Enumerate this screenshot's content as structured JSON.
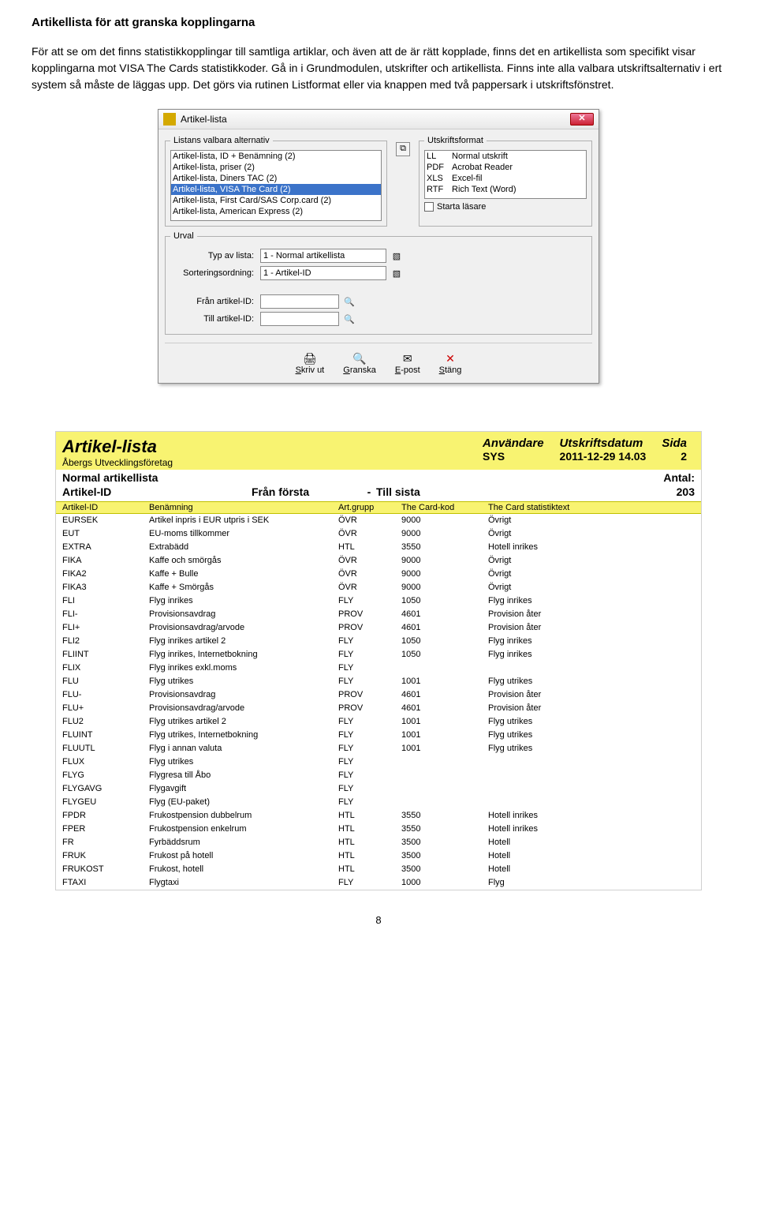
{
  "doc": {
    "title": "Artikellista för att granska kopplingarna",
    "body": "För att se om det finns statistikkopplingar till samtliga artiklar, och även att de är rätt kopplade, finns det en artikellista som specifikt visar kopplingarna mot VISA The Cards statistikkoder. Gå in i Grundmodulen, utskrifter och artikellista. Finns inte alla valbara utskriftsalternativ i ert system så måste de läggas upp. Det görs via rutinen Listformat eller via knappen med två pappersark i utskriftsfönstret."
  },
  "dialog": {
    "title": "Artikel-lista",
    "fs_listans": "Listans valbara alternativ",
    "fs_utskrift": "Utskriftsformat",
    "fs_urval": "Urval",
    "list_items": [
      "Artikel-lista, ID + Benämning (2)",
      "Artikel-lista, priser (2)",
      "Artikel-lista, Diners TAC (2)",
      "Artikel-lista, VISA The Card (2)",
      "Artikel-lista, First Card/SAS Corp.card (2)",
      "Artikel-lista, American Express (2)"
    ],
    "list_selected": 3,
    "formats": [
      {
        "c": "LL",
        "n": "Normal utskrift"
      },
      {
        "c": "PDF",
        "n": "Acrobat Reader"
      },
      {
        "c": "XLS",
        "n": "Excel-fil"
      },
      {
        "c": "RTF",
        "n": "Rich Text (Word)"
      }
    ],
    "starta_lasare": "Starta läsare",
    "lbl_typ": "Typ av lista:",
    "lbl_sort": "Sorteringsordning:",
    "val_typ": "1  - Normal artikellista",
    "val_sort": "1  - Artikel-ID",
    "lbl_fran": "Från artikel-ID:",
    "lbl_till": "Till artikel-ID:",
    "btn_skrivut_pre": "S",
    "btn_skrivut": "kriv ut",
    "btn_granska_pre": "G",
    "btn_granska": "ranska",
    "btn_epost_pre": "E",
    "btn_epost": "-post",
    "btn_stang_pre": "S",
    "btn_stang": "täng"
  },
  "report": {
    "title": "Artikel-lista",
    "company": "Åbergs Utvecklingsföretag",
    "h_user": "Användare",
    "v_user": "SYS",
    "h_date": "Utskriftsdatum",
    "v_date": "2011-12-29 14.03",
    "h_page": "Sida",
    "v_page": "2",
    "sub1": "Normal artikellista",
    "antal_lbl": "Antal:",
    "sub2_id": "Artikel-ID",
    "sub2_fran": "Från första",
    "sub2_dash": "-",
    "sub2_till": "Till sista",
    "antal_val": "203",
    "cols": {
      "id": "Artikel-ID",
      "ben": "Benämning",
      "grp": "Art.grupp",
      "kod": "The Card-kod",
      "txt": "The Card statistiktext"
    },
    "rows": [
      {
        "id": "EURSEK",
        "ben": "Artikel inpris i EUR utpris i SEK",
        "grp": "ÖVR",
        "kod": "9000",
        "txt": "Övrigt"
      },
      {
        "id": "EUT",
        "ben": "EU-moms tillkommer",
        "grp": "ÖVR",
        "kod": "9000",
        "txt": "Övrigt"
      },
      {
        "id": "EXTRA",
        "ben": "Extrabädd",
        "grp": "HTL",
        "kod": "3550",
        "txt": "Hotell inrikes"
      },
      {
        "id": "FIKA",
        "ben": "Kaffe och smörgås",
        "grp": "ÖVR",
        "kod": "9000",
        "txt": "Övrigt"
      },
      {
        "id": "FIKA2",
        "ben": "Kaffe + Bulle",
        "grp": "ÖVR",
        "kod": "9000",
        "txt": "Övrigt"
      },
      {
        "id": "FIKA3",
        "ben": "Kaffe + Smörgås",
        "grp": "ÖVR",
        "kod": "9000",
        "txt": "Övrigt"
      },
      {
        "id": "FLI",
        "ben": "Flyg inrikes",
        "grp": "FLY",
        "kod": "1050",
        "txt": "Flyg inrikes"
      },
      {
        "id": "FLI-",
        "ben": "Provisionsavdrag",
        "grp": "PROV",
        "kod": "4601",
        "txt": "Provision åter"
      },
      {
        "id": "FLI+",
        "ben": "Provisionsavdrag/arvode",
        "grp": "PROV",
        "kod": "4601",
        "txt": "Provision åter"
      },
      {
        "id": "FLI2",
        "ben": "Flyg inrikes artikel 2",
        "grp": "FLY",
        "kod": "1050",
        "txt": "Flyg inrikes"
      },
      {
        "id": "FLIINT",
        "ben": "Flyg inrikes, Internetbokning",
        "grp": "FLY",
        "kod": "1050",
        "txt": "Flyg inrikes"
      },
      {
        "id": "FLIX",
        "ben": "Flyg inrikes exkl.moms",
        "grp": "FLY",
        "kod": "",
        "txt": ""
      },
      {
        "id": "FLU",
        "ben": "Flyg utrikes",
        "grp": "FLY",
        "kod": "1001",
        "txt": "Flyg utrikes"
      },
      {
        "id": "FLU-",
        "ben": "Provisionsavdrag",
        "grp": "PROV",
        "kod": "4601",
        "txt": "Provision åter"
      },
      {
        "id": "FLU+",
        "ben": "Provisionsavdrag/arvode",
        "grp": "PROV",
        "kod": "4601",
        "txt": "Provision åter"
      },
      {
        "id": "FLU2",
        "ben": "Flyg utrikes artikel 2",
        "grp": "FLY",
        "kod": "1001",
        "txt": "Flyg utrikes"
      },
      {
        "id": "FLUINT",
        "ben": "Flyg utrikes, Internetbokning",
        "grp": "FLY",
        "kod": "1001",
        "txt": "Flyg utrikes"
      },
      {
        "id": "FLUUTL",
        "ben": "Flyg i annan valuta",
        "grp": "FLY",
        "kod": "1001",
        "txt": "Flyg utrikes"
      },
      {
        "id": "FLUX",
        "ben": "Flyg utrikes",
        "grp": "FLY",
        "kod": "",
        "txt": ""
      },
      {
        "id": "FLYG",
        "ben": "Flygresa till Åbo",
        "grp": "FLY",
        "kod": "",
        "txt": ""
      },
      {
        "id": "FLYGAVG",
        "ben": "Flygavgift",
        "grp": "FLY",
        "kod": "",
        "txt": ""
      },
      {
        "id": "FLYGEU",
        "ben": "Flyg (EU-paket)",
        "grp": "FLY",
        "kod": "",
        "txt": ""
      },
      {
        "id": "FPDR",
        "ben": "Frukostpension dubbelrum",
        "grp": "HTL",
        "kod": "3550",
        "txt": "Hotell inrikes"
      },
      {
        "id": "FPER",
        "ben": "Frukostpension enkelrum",
        "grp": "HTL",
        "kod": "3550",
        "txt": "Hotell inrikes"
      },
      {
        "id": "FR",
        "ben": "Fyrbäddsrum",
        "grp": "HTL",
        "kod": "3500",
        "txt": "Hotell"
      },
      {
        "id": "FRUK",
        "ben": "Frukost på hotell",
        "grp": "HTL",
        "kod": "3500",
        "txt": "Hotell"
      },
      {
        "id": "FRUKOST",
        "ben": "Frukost, hotell",
        "grp": "HTL",
        "kod": "3500",
        "txt": "Hotell"
      },
      {
        "id": "FTAXI",
        "ben": "Flygtaxi",
        "grp": "FLY",
        "kod": "1000",
        "txt": "Flyg"
      }
    ]
  },
  "page_num": "8"
}
